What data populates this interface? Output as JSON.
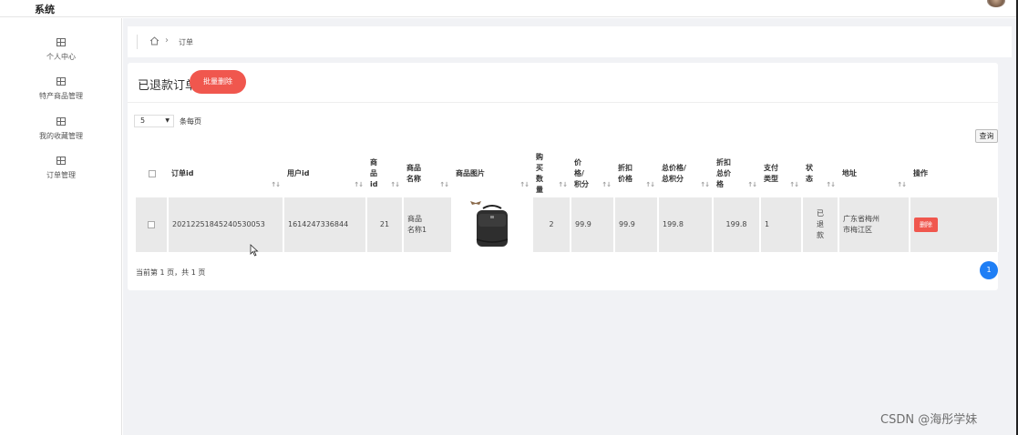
{
  "app": {
    "title": "系统"
  },
  "sidebar": {
    "items": [
      {
        "label": "个人中心",
        "icon": "table-icon"
      },
      {
        "label": "特产商品管理",
        "icon": "table-icon"
      },
      {
        "label": "我的收藏管理",
        "icon": "table-icon"
      },
      {
        "label": "订单管理",
        "icon": "table-icon"
      }
    ]
  },
  "breadcrumb": {
    "current": "订单",
    "home_icon": "home-icon"
  },
  "page": {
    "title": "已退款订单",
    "batch_delete_label": "批量删除",
    "page_size": "5",
    "page_size_suffix": "条每页",
    "query_label": "查询"
  },
  "table": {
    "columns": [
      {
        "key": "select",
        "label": ""
      },
      {
        "key": "order_id",
        "label": "订单id"
      },
      {
        "key": "user_id",
        "label": "用户id"
      },
      {
        "key": "product_id",
        "label": "商\n品\nid"
      },
      {
        "key": "product_name",
        "label": "商品\n名称"
      },
      {
        "key": "product_image",
        "label": "商品图片"
      },
      {
        "key": "quantity",
        "label": "购\n买\n数\n量"
      },
      {
        "key": "price",
        "label": "价\n格/\n积分"
      },
      {
        "key": "discount_price",
        "label": "折扣\n价格"
      },
      {
        "key": "total_price",
        "label": "总价格/\n总积分"
      },
      {
        "key": "discount_total",
        "label": "折扣\n总价\n格"
      },
      {
        "key": "pay_type",
        "label": "支付\n类型"
      },
      {
        "key": "status",
        "label": "状\n态"
      },
      {
        "key": "address",
        "label": "地址"
      },
      {
        "key": "actions",
        "label": "操作"
      }
    ],
    "rows": [
      {
        "order_id": "20212251845240530053",
        "user_id": "1614247336844",
        "product_id": "21",
        "product_name": "商品\n名称1",
        "quantity": "2",
        "price": "99.9",
        "discount_price": "99.9",
        "total_price": "199.8",
        "discount_total": "199.8",
        "pay_type": "1",
        "status": "已\n退\n款",
        "address": "广东省梅州\n市梅江区",
        "delete_label": "删除"
      }
    ]
  },
  "pagination": {
    "info": "当前第 1 页，共 1 页",
    "current_page": "1"
  },
  "watermark": "CSDN @海彤学妹",
  "colors": {
    "accent_red": "#f0574e",
    "accent_blue": "#1e7ef5",
    "background": "#f1f2f5"
  }
}
